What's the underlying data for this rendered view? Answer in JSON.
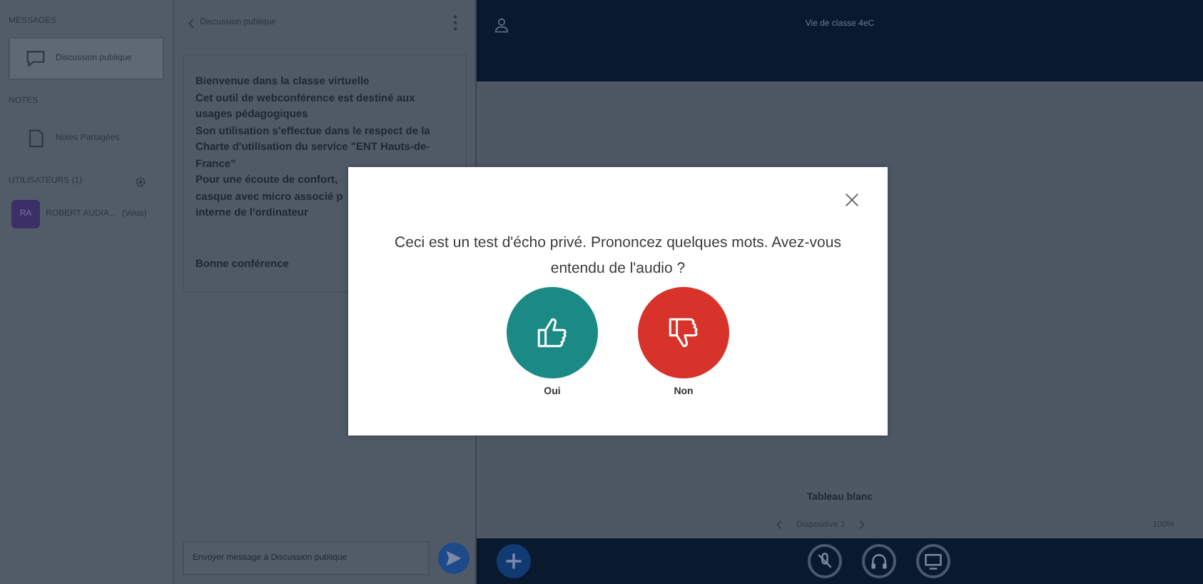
{
  "users_panel": {
    "messages_heading": "MESSAGES",
    "chat_item": {
      "label": "Discussion publique",
      "selected": true
    },
    "notes_heading": "NOTES",
    "notes_item": "Notes Partagées",
    "users_heading": "UTILISATEURS (1)",
    "user": {
      "initials": "RA",
      "name": "ROBERT AUDIA...",
      "suffix": "(Vous)"
    }
  },
  "chat": {
    "back_label": "Discussion publique",
    "message_lines": [
      "Bienvenue dans la classe virtuelle",
      "Cet outil de webconférence est destiné aux",
      "usages pédagogiques",
      "Son utilisation s'effectue dans le respect de la",
      "Charte d'utilisation du service \"ENT Hauts-de-",
      "France\"",
      "Pour une écoute de confort,",
      "casque avec micro associé p",
      "interne de l'ordinateur"
    ],
    "closing": "Bonne conférence",
    "input": {
      "placeholder": "Envoyer message à Discussion publique"
    }
  },
  "main": {
    "title": "Vie de classe 4eC",
    "whiteboard_label": "Tableau blanc",
    "slide_selector": "Diapositive 1",
    "zoom": "100%"
  },
  "modal": {
    "message": "Ceci est un test d'écho privé. Prononcez quelques mots. Avez-vous entendu de l'audio ?",
    "answers": [
      {
        "kind": "yes",
        "label": "Oui",
        "color": "#1b8a84"
      },
      {
        "kind": "no",
        "label": "Non",
        "color": "#d8332a"
      }
    ]
  }
}
